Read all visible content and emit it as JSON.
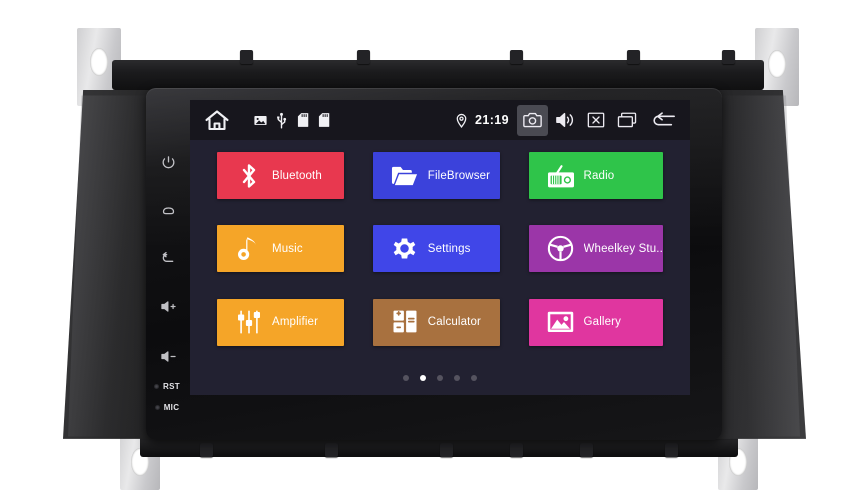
{
  "device": {
    "type": "car-head-unit",
    "hardkeys": [
      {
        "name": "power",
        "icon": "power-icon"
      },
      {
        "name": "home",
        "icon": "home-outline-icon"
      },
      {
        "name": "back",
        "icon": "back-arrow-icon"
      },
      {
        "name": "volume-up",
        "icon": "volume-up-icon"
      },
      {
        "name": "volume-down",
        "icon": "volume-down-icon"
      }
    ],
    "pinholes": [
      {
        "label": "RST"
      },
      {
        "label": "MIC"
      }
    ]
  },
  "statusbar": {
    "home_icon": "home-icon",
    "tray_icons": [
      {
        "name": "image-icon"
      },
      {
        "name": "usb-icon"
      },
      {
        "name": "sdcard-icon"
      },
      {
        "name": "sdcard-icon-2"
      }
    ],
    "location_icon": "location-pin-icon",
    "clock": "21:19",
    "buttons": [
      {
        "name": "camera-button",
        "icon": "camera-icon",
        "active": true
      },
      {
        "name": "volume-button",
        "icon": "volume-icon",
        "active": false
      },
      {
        "name": "close-button",
        "icon": "x-box-icon",
        "active": false
      },
      {
        "name": "recent-apps-button",
        "icon": "recent-apps-icon",
        "active": false
      },
      {
        "name": "back-button",
        "icon": "back-arrow-icon",
        "active": false
      }
    ]
  },
  "screen": {
    "background": "#222131",
    "statusbar_background": "#17161d"
  },
  "apps": [
    {
      "label": "Bluetooth",
      "icon": "bluetooth-icon",
      "color": "#e8384f"
    },
    {
      "label": "FileBrowser",
      "icon": "folder-icon",
      "color": "#3b42db"
    },
    {
      "label": "Radio",
      "icon": "radio-icon",
      "color": "#2fc44a"
    },
    {
      "label": "Music",
      "icon": "music-note-icon",
      "color": "#f5a528"
    },
    {
      "label": "Settings",
      "icon": "gear-icon",
      "color": "#4046e8"
    },
    {
      "label": "Wheelkey Stu..",
      "icon": "steering-wheel-icon",
      "color": "#9b36a8"
    },
    {
      "label": "Amplifier",
      "icon": "equalizer-icon",
      "color": "#f5a528"
    },
    {
      "label": "Calculator",
      "icon": "calculator-icon",
      "color": "#a8713f"
    },
    {
      "label": "Gallery",
      "icon": "photo-icon",
      "color": "#e0369f"
    }
  ],
  "pager": {
    "total": 5,
    "active_index": 1
  }
}
